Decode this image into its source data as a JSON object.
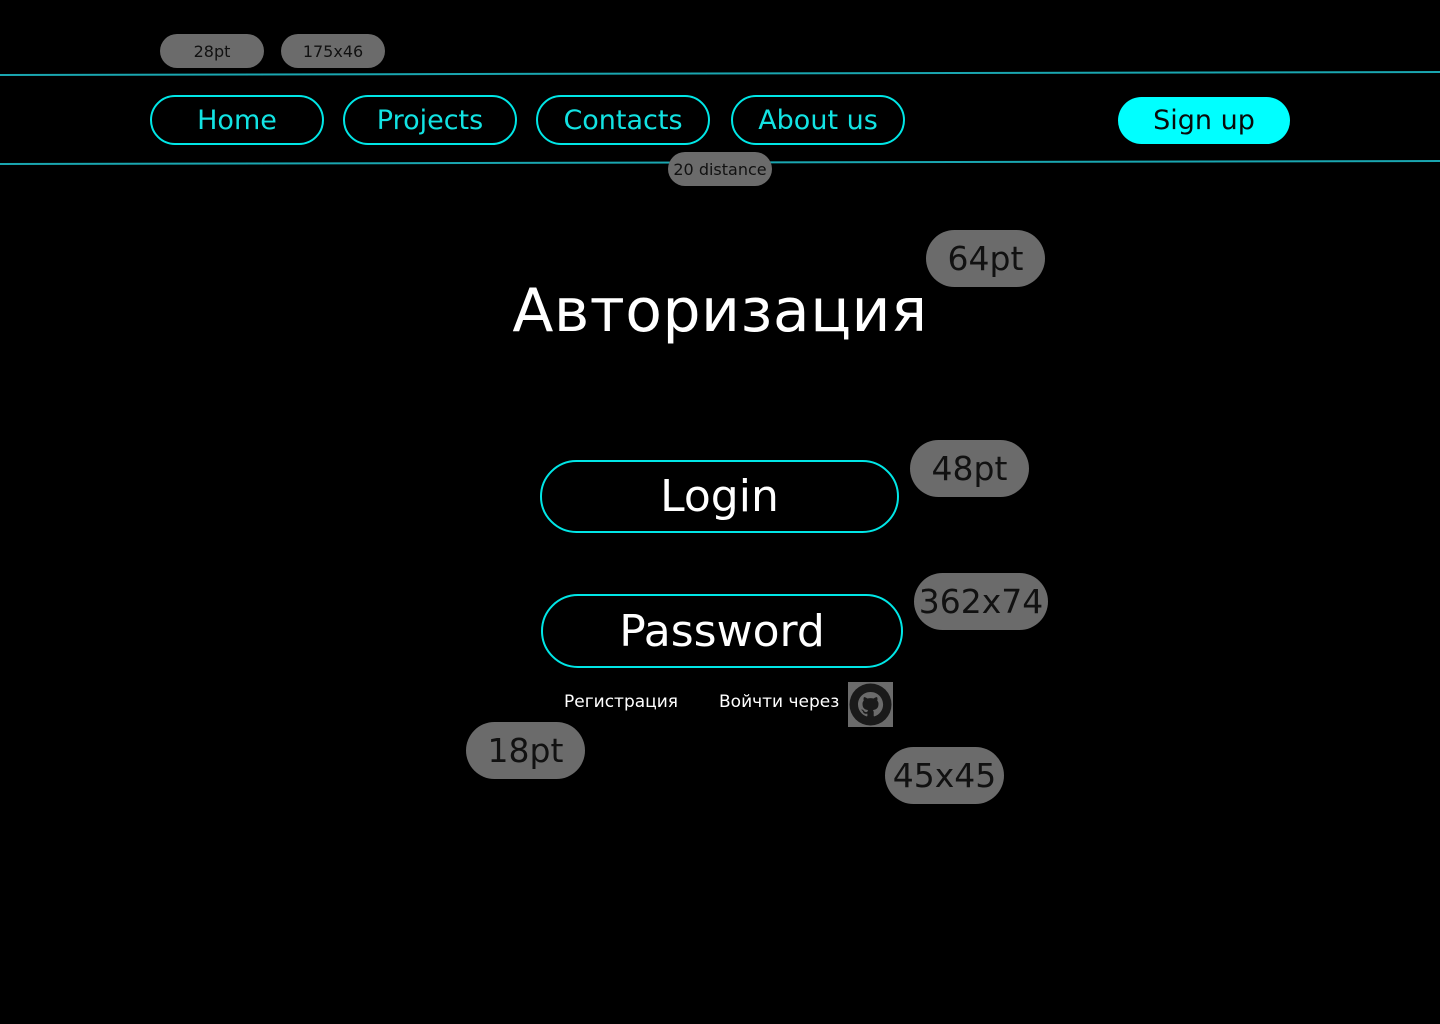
{
  "annotations": {
    "nav_font_size": "28pt",
    "nav_button_size": "175x46",
    "nav_distance": "20 distance",
    "title_font_size": "64pt",
    "field_font_size": "48pt",
    "field_size": "362x74",
    "link_font_size": "18pt",
    "icon_size": "45x45"
  },
  "nav": {
    "items": [
      {
        "label": "Home"
      },
      {
        "label": "Projects"
      },
      {
        "label": "Contacts"
      },
      {
        "label": "About us"
      }
    ],
    "signup_label": "Sign up"
  },
  "main": {
    "title": "Авторизация",
    "login_label": "Login",
    "password_label": "Password",
    "register_link": "Регистрация",
    "login_via_label": "Войчти через",
    "login_via_icon": "github-icon"
  },
  "colors": {
    "accent": "#00ffff",
    "background": "#000000",
    "annotation_bg": "#6b6b6b"
  }
}
